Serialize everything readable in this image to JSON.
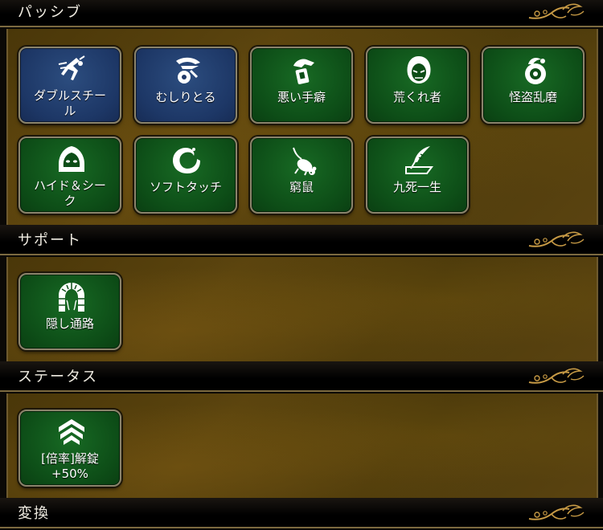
{
  "sections": [
    {
      "title": "パッシブ",
      "skills": [
        {
          "label": "ダブルスチール",
          "label2": "ル",
          "label1": "ダブルスチー",
          "color": "blue",
          "icon": "running-thief-icon"
        },
        {
          "label": "むしりとる",
          "color": "blue",
          "icon": "claw-grab-icon"
        },
        {
          "label": "悪い手癖",
          "color": "green",
          "icon": "grabbing-hand-icon"
        },
        {
          "label": "荒くれ者",
          "color": "green",
          "icon": "hooded-face-icon"
        },
        {
          "label": "怪盗乱磨",
          "color": "green",
          "icon": "treasure-bag-icon"
        },
        {
          "label": "ハイド＆シーク",
          "label1": "ハイド＆シー",
          "label2": "ク",
          "color": "green",
          "icon": "hood-eyes-icon"
        },
        {
          "label": "ソフトタッチ",
          "color": "green",
          "icon": "crescent-curl-icon"
        },
        {
          "label": "窮鼠",
          "color": "green",
          "icon": "mouse-icon"
        },
        {
          "label": "九死一生",
          "color": "green",
          "icon": "feather-quill-icon"
        }
      ]
    },
    {
      "title": "サポート",
      "skills": [
        {
          "label": "隠し通路",
          "color": "green",
          "icon": "stone-archway-icon"
        }
      ]
    },
    {
      "title": "ステータス",
      "skills": [
        {
          "label": "[倍率]解錠",
          "label1": "[倍率]解錠",
          "label2": "+50%",
          "color": "green",
          "icon": "chevron-rank-up-icon"
        }
      ]
    },
    {
      "title": "変換",
      "skills": []
    }
  ],
  "colors": {
    "tile_green": "#0d4d17",
    "tile_blue": "#1d3766",
    "panel_gold": "#4f3b0c",
    "ornament": "#c79a45"
  }
}
